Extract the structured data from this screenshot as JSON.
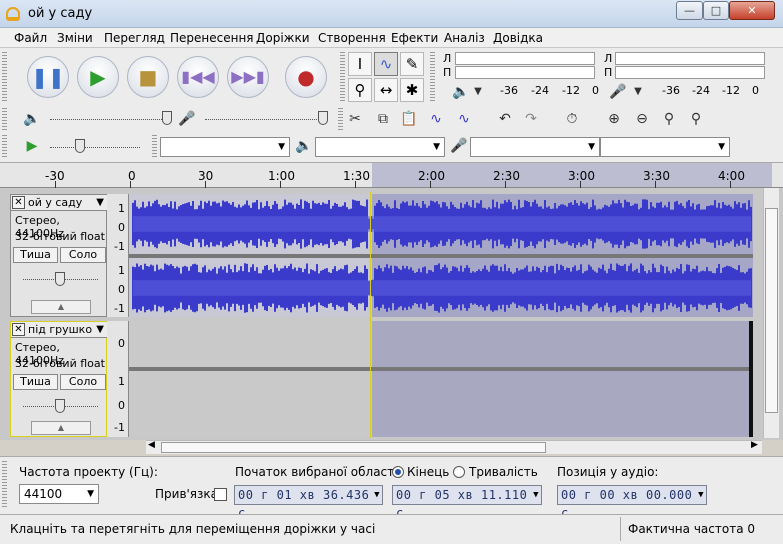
{
  "window": {
    "title": "ой у саду"
  },
  "menu": [
    "Файл",
    "Зміни",
    "Перегляд",
    "Перенесення",
    "Доріжки",
    "Створення",
    "Ефекти",
    "Аналіз",
    "Довідка"
  ],
  "meters": {
    "playback_channels": [
      "Л",
      "П"
    ],
    "record_channels": [
      "Л",
      "П"
    ],
    "ticks": [
      "-36",
      "-24",
      "-12",
      "0"
    ]
  },
  "ruler": {
    "labels": [
      "-30",
      "0",
      "30",
      "1:00",
      "1:30",
      "2:00",
      "2:30",
      "3:00",
      "3:30",
      "4:00"
    ],
    "selection_start_seconds": 104,
    "selection_end_seconds": 251
  },
  "tracks": [
    {
      "name": "ой у саду",
      "info1": "Стерео, 44100Hz",
      "info2": "32-бітовий float",
      "mute_label": "Тиша",
      "solo_label": "Соло",
      "scale": [
        "1",
        "0",
        "-1"
      ]
    },
    {
      "name": "під грушко",
      "info1": "Стерео, 44100Hz",
      "info2": "32-бітовий float",
      "mute_label": "Тиша",
      "solo_label": "Соло",
      "scale": [
        "0",
        "1",
        "0",
        "-1"
      ]
    }
  ],
  "selection_bar": {
    "rate_label": "Частота проекту (Гц):",
    "rate_value": "44100",
    "snap_label": "Прив'язка",
    "start_label": "Початок вибраної області:",
    "end_label": "Кінець",
    "length_label": "Тривалість",
    "audio_pos_label": "Позиція у аудіо:",
    "start_time": "00 г 01 хв 36.436 с",
    "end_time": "00 г 05 хв 11.110 с",
    "audio_pos_time": "00 г 00 хв 00.000 с"
  },
  "status": {
    "left": "Клацніть та перетягніть для переміщення доріжки у часі",
    "right": "Фактична частота 0"
  },
  "colors": {
    "waveform": "#3a3acb",
    "waveform_peak": "#5c62e0",
    "selection": "#9c9cc0"
  }
}
